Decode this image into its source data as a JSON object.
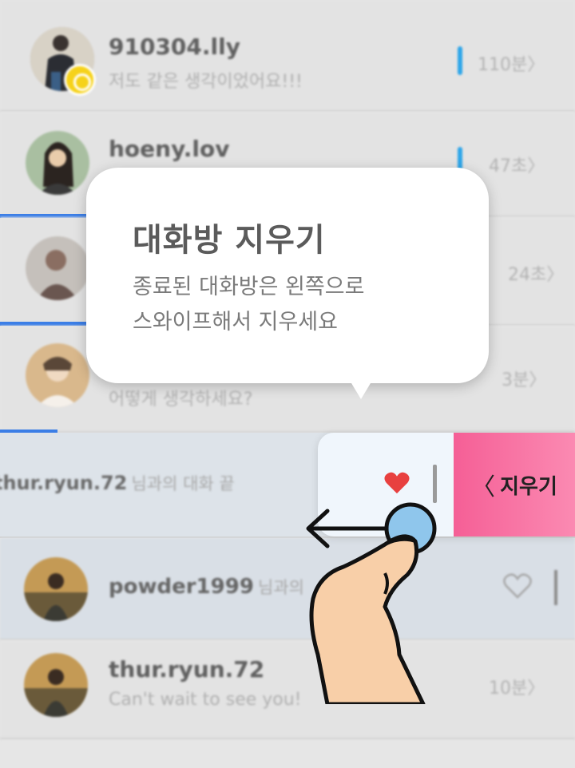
{
  "conversations": [
    {
      "username": "910304.lly",
      "message": "저도 같은 생각이었어요!!!",
      "time": "110분",
      "unread": true
    },
    {
      "username": "hoeny.lov",
      "message": "",
      "time": "47초",
      "unread": true
    },
    {
      "username": "",
      "message": "",
      "time": "24초",
      "unread": false
    },
    {
      "username": "",
      "message": "어떻게 생각하세요?",
      "time": "3분",
      "unread": false
    },
    {
      "username": "thur.ryun.72",
      "message": "님과의 대화 끝",
      "time": "",
      "ended": true
    },
    {
      "username": "powder1999",
      "message": "님과의",
      "time": "",
      "unread": false
    },
    {
      "username": "thur.ryun.72",
      "message": "Can't wait to see you!",
      "time": "10분",
      "unread": false
    }
  ],
  "tooltip": {
    "title": "대화방 지우기",
    "line1": "종료된 대화방은 왼쪽으로",
    "line2": "스와이프해서 지우세요"
  },
  "swipe_actions": {
    "delete_label": "지우기",
    "chevron": "〈"
  },
  "colors": {
    "accent_blue": "#2ea6e9",
    "delete_pink": "#f55f96",
    "heart_red": "#e8403f"
  }
}
